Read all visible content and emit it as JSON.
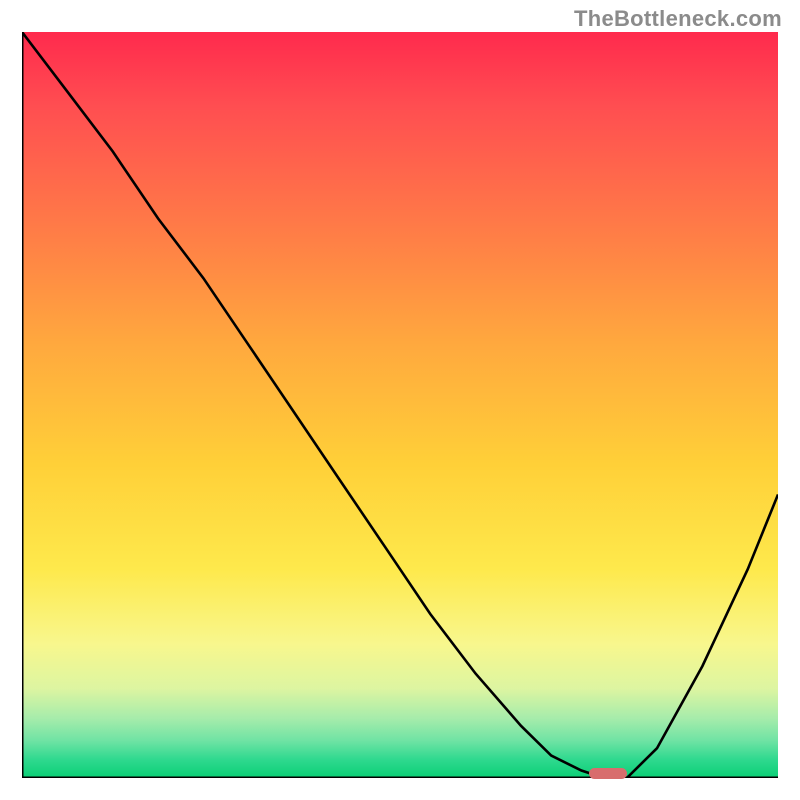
{
  "watermark": "TheBottleneck.com",
  "colors": {
    "gradient_top": "#ff2a4d",
    "gradient_mid": "#ffd038",
    "gradient_bottom": "#0acf75",
    "axis": "#000000",
    "curve": "#000000",
    "marker": "#d86d6d",
    "watermark_text": "#8b8b8b"
  },
  "chart_data": {
    "type": "line",
    "title": "",
    "xlabel": "",
    "ylabel": "",
    "xlim": [
      0,
      100
    ],
    "ylim": [
      0,
      100
    ],
    "note": "Axes unlabeled; values are relative percentages estimated from pixel positions. Higher y = higher vertical position (toward red end).",
    "series": [
      {
        "name": "bottleneck-curve",
        "x": [
          0,
          6,
          12,
          18,
          24,
          30,
          36,
          42,
          48,
          54,
          60,
          66,
          70,
          74,
          77,
          80,
          84,
          90,
          96,
          100
        ],
        "y": [
          100,
          92,
          84,
          75,
          67,
          58,
          49,
          40,
          31,
          22,
          14,
          7,
          3,
          1,
          0,
          0,
          4,
          15,
          28,
          38
        ]
      }
    ],
    "marker": {
      "name": "optimum-range",
      "x_range": [
        75,
        80
      ],
      "y": 0.6
    },
    "legend": null,
    "grid": false
  }
}
